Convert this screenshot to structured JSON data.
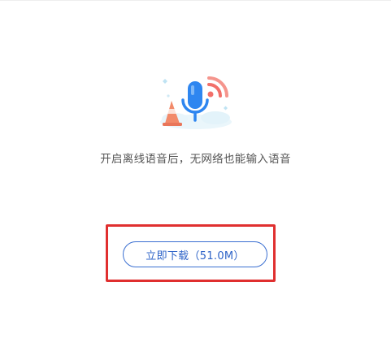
{
  "illustration": {
    "icon": "microphone-icon",
    "accent_color": "#2e86f0",
    "secondary_color": "#f2706a"
  },
  "description": "开启离线语音后，无网络也能输入语音",
  "download": {
    "label": "立即下载（51.0M）",
    "color": "#2f64c8"
  },
  "highlight": {
    "color": "#e02f2f"
  }
}
